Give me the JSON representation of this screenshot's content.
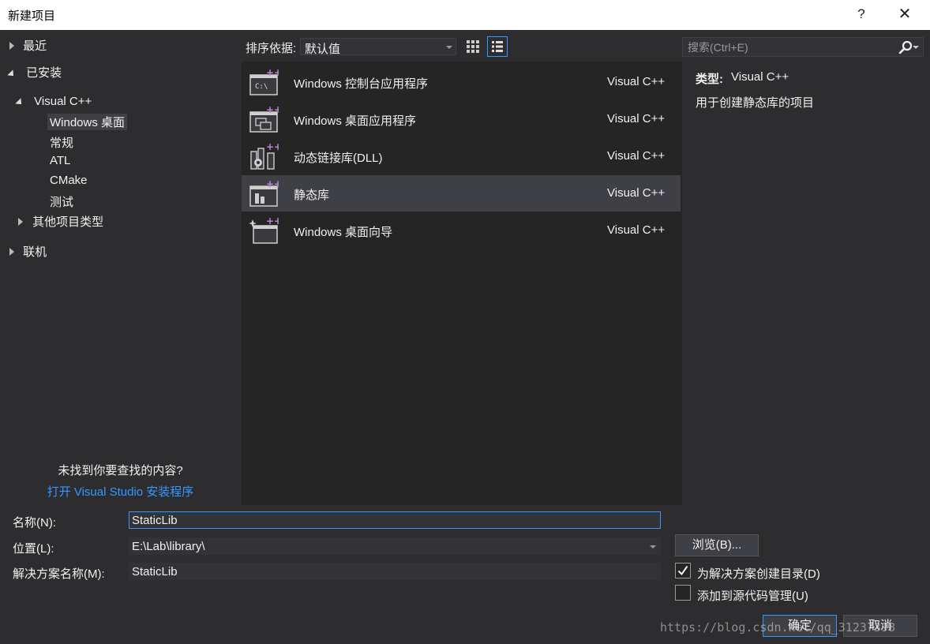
{
  "window": {
    "title": "新建项目",
    "help_label": "?",
    "close_label": "✕"
  },
  "left_panel": {
    "recent": "最近",
    "installed": "已安装",
    "visual_cpp": "Visual C++",
    "cpp_children": [
      "Windows 桌面",
      "常规",
      "ATL",
      "CMake",
      "测试"
    ],
    "other_project_types": "其他项目类型",
    "online": "联机",
    "not_found": "未找到你要查找的内容?",
    "open_installer": "打开 Visual Studio 安装程序"
  },
  "toolbar": {
    "sort_label": "排序依据:",
    "sort_value": "默认值"
  },
  "templates": [
    {
      "name": "Windows 控制台应用程序",
      "lang": "Visual C++",
      "icon": "console-app-icon"
    },
    {
      "name": "Windows 桌面应用程序",
      "lang": "Visual C++",
      "icon": "desktop-app-icon"
    },
    {
      "name": "动态链接库(DLL)",
      "lang": "Visual C++",
      "icon": "dll-icon"
    },
    {
      "name": "静态库",
      "lang": "Visual C++",
      "icon": "static-lib-icon",
      "selected": true
    },
    {
      "name": "Windows 桌面向导",
      "lang": "Visual C++",
      "icon": "desktop-wizard-icon"
    }
  ],
  "right_panel": {
    "search_placeholder": "搜索(Ctrl+E)",
    "type_label": "类型:",
    "type_value": "Visual C++",
    "description": "用于创建静态库的项目"
  },
  "form": {
    "name_label": "名称(N):",
    "name_value": "StaticLib",
    "location_label": "位置(L):",
    "location_value": "E:\\Lab\\library\\",
    "solution_label": "解决方案名称(M):",
    "solution_value": "StaticLib",
    "browse_label": "浏览(B)...",
    "create_dir_label": "为解决方案创建目录(D)",
    "create_dir_checked": true,
    "source_control_label": "添加到源代码管理(U)",
    "source_control_checked": false,
    "ok_label": "确定",
    "cancel_label": "取消"
  },
  "watermark": "https://blog.csdn.net/qq_31237398",
  "colors": {
    "accent": "#3399ff",
    "plus_magenta": "#c27fd6",
    "background": "#2d2d30",
    "list_bg": "#252526"
  }
}
